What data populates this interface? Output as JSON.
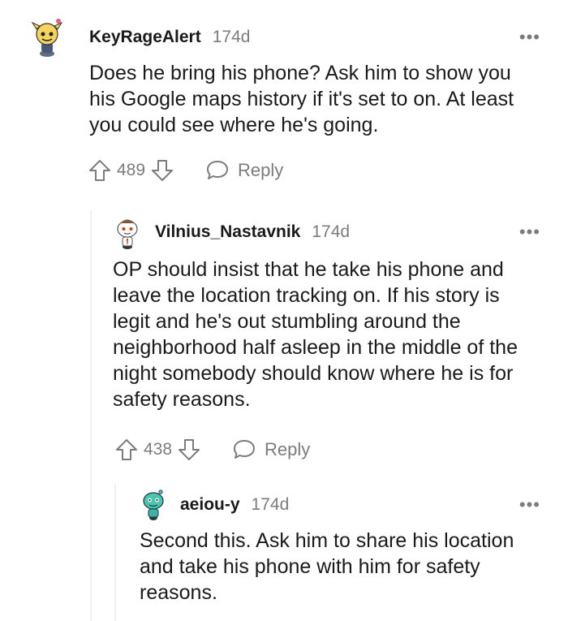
{
  "thread": {
    "comments": [
      {
        "username": "KeyRageAlert",
        "age": "174d",
        "avatar_icon": "snoo-avatar-yellow-icon",
        "body": "Does he bring his phone? Ask him to show you his Google maps history if it's set to on. At least you could see where he's going.",
        "score": "489",
        "reply_label": "Reply",
        "more_label": "•••"
      },
      {
        "username": "Vilnius_Nastavnik",
        "age": "174d",
        "avatar_icon": "snoo-avatar-white-icon",
        "body": "OP should insist that he take his phone and leave the location tracking on. If his story is legit and he's out stumbling around the neighborhood half asleep in the middle of the night somebody should know where he is for safety reasons.",
        "score": "438",
        "reply_label": "Reply",
        "more_label": "•••"
      },
      {
        "username": "aeiou-y",
        "age": "174d",
        "avatar_icon": "snoo-avatar-teal-icon",
        "body": "Second this. Ask him to share his location and take his phone with him for safety reasons.",
        "more_label": "•••"
      }
    ]
  }
}
